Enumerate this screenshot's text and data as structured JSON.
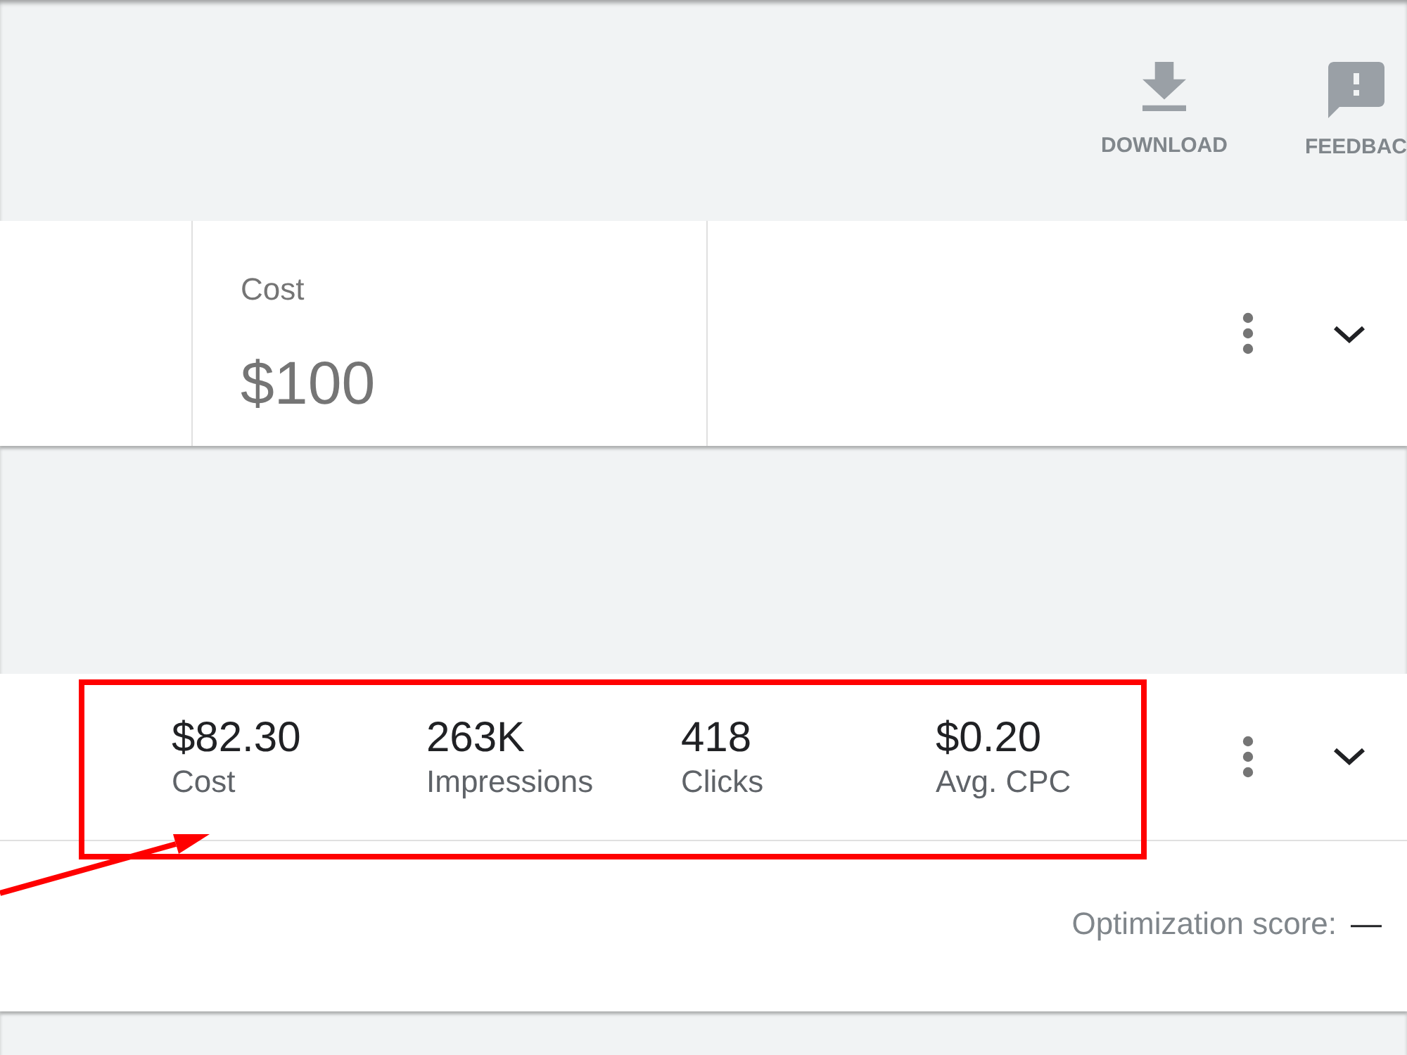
{
  "toolbar": {
    "buttons": [
      {
        "kind": "download",
        "label": "DOWNLOAD"
      },
      {
        "kind": "feedback",
        "label": "FEEDBAC"
      }
    ]
  },
  "budget_card": {
    "metric": {
      "label": "Cost",
      "value": "$100"
    }
  },
  "campaign_card": {
    "highlighted": true,
    "metrics": [
      {
        "value": "$82.30",
        "label": "Cost"
      },
      {
        "value": "263K",
        "label": "Impressions"
      },
      {
        "value": "418",
        "label": "Clicks"
      },
      {
        "value": "$0.20",
        "label": "Avg. CPC"
      }
    ],
    "optimization": {
      "label": "Optimization score:",
      "value": "—"
    }
  }
}
